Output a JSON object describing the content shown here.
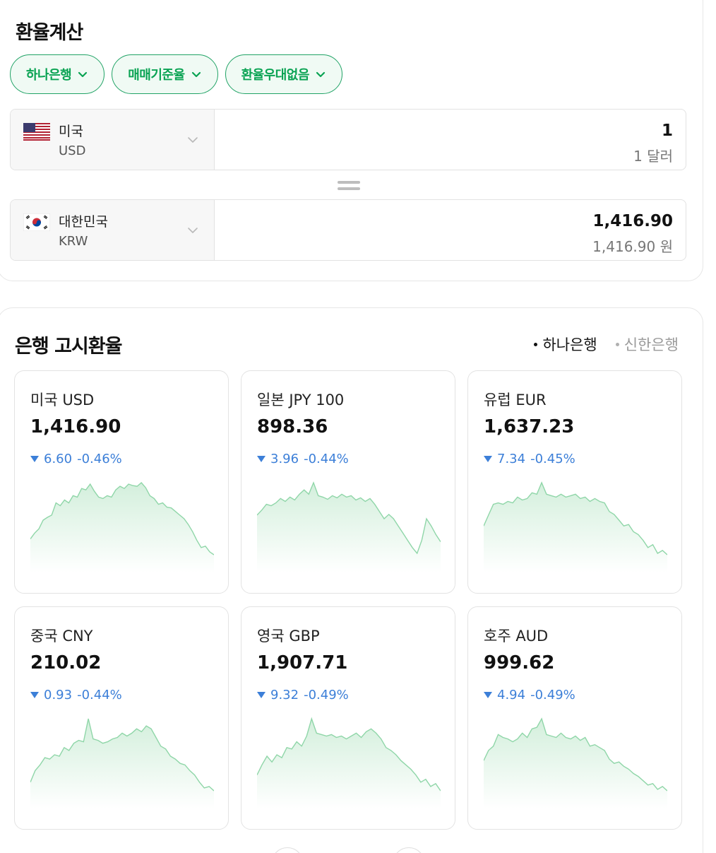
{
  "calculator": {
    "title": "환율계산",
    "filters": [
      {
        "label": "하나은행"
      },
      {
        "label": "매매기준율"
      },
      {
        "label": "환율우대없음"
      }
    ],
    "from": {
      "name": "미국",
      "code": "USD",
      "value": "1",
      "sub": "1 달러",
      "flag": "us-flag-icon"
    },
    "to": {
      "name": "대한민국",
      "code": "KRW",
      "value": "1,416.90",
      "sub": "1,416.90 원",
      "flag": "kr-flag-icon"
    }
  },
  "rates": {
    "title": "은행 고시환율",
    "banks": [
      {
        "label": "하나은행",
        "active": true
      },
      {
        "label": "신한은행",
        "active": false
      }
    ],
    "cards": [
      {
        "name": "미국 USD",
        "rate": "1,416.90",
        "change": "6.60",
        "pct": "-0.46%",
        "trend": [
          0.22,
          0.3,
          0.36,
          0.48,
          0.52,
          0.55,
          0.72,
          0.68,
          0.76,
          0.72,
          0.82,
          0.8,
          0.92,
          0.9,
          0.98,
          0.88,
          0.8,
          0.78,
          0.82,
          0.8,
          0.9,
          0.95,
          0.92,
          0.98,
          0.96,
          0.95,
          1.0,
          0.93,
          0.82,
          0.78,
          0.7,
          0.72,
          0.66,
          0.65,
          0.6,
          0.55,
          0.5,
          0.42,
          0.32,
          0.2,
          0.1,
          0.12,
          0.04,
          0.0
        ]
      },
      {
        "name": "일본 JPY 100",
        "rate": "898.36",
        "change": "3.96",
        "pct": "-0.44%",
        "trend": [
          0.55,
          0.62,
          0.7,
          0.68,
          0.72,
          0.78,
          0.74,
          0.8,
          0.76,
          0.84,
          0.9,
          0.84,
          1.0,
          0.82,
          0.8,
          0.77,
          0.82,
          0.79,
          0.84,
          0.8,
          0.82,
          0.76,
          0.79,
          0.74,
          0.78,
          0.7,
          0.6,
          0.5,
          0.56,
          0.5,
          0.4,
          0.3,
          0.2,
          0.1,
          0.02,
          0.2,
          0.5,
          0.4,
          0.28,
          0.18
        ]
      },
      {
        "name": "유럽 EUR",
        "rate": "1,637.23",
        "change": "7.34",
        "pct": "-0.45%",
        "trend": [
          0.4,
          0.55,
          0.7,
          0.72,
          0.7,
          0.74,
          0.72,
          0.8,
          0.76,
          0.78,
          0.86,
          0.84,
          1.0,
          0.84,
          0.82,
          0.8,
          0.84,
          0.8,
          0.82,
          0.84,
          0.78,
          0.8,
          0.74,
          0.78,
          0.74,
          0.72,
          0.6,
          0.56,
          0.48,
          0.4,
          0.42,
          0.32,
          0.28,
          0.2,
          0.1,
          0.14,
          0.02,
          0.06,
          0.0
        ]
      },
      {
        "name": "중국 CNY",
        "rate": "210.02",
        "change": "0.93",
        "pct": "-0.44%",
        "trend": [
          0.12,
          0.28,
          0.36,
          0.46,
          0.44,
          0.5,
          0.48,
          0.6,
          0.56,
          0.66,
          0.7,
          0.68,
          1.0,
          0.72,
          0.7,
          0.66,
          0.68,
          0.72,
          0.74,
          0.8,
          0.76,
          0.8,
          0.86,
          0.82,
          0.9,
          0.86,
          0.74,
          0.62,
          0.58,
          0.48,
          0.44,
          0.38,
          0.36,
          0.28,
          0.22,
          0.12,
          0.04,
          0.06,
          0.0
        ]
      },
      {
        "name": "영국 GBP",
        "rate": "1,907.71",
        "change": "9.32",
        "pct": "-0.49%",
        "trend": [
          0.22,
          0.36,
          0.48,
          0.4,
          0.5,
          0.46,
          0.6,
          0.58,
          0.68,
          0.62,
          0.76,
          1.0,
          0.8,
          0.78,
          0.76,
          0.78,
          0.74,
          0.76,
          0.72,
          0.76,
          0.8,
          0.74,
          0.82,
          0.86,
          0.8,
          0.72,
          0.6,
          0.56,
          0.5,
          0.42,
          0.36,
          0.3,
          0.22,
          0.12,
          0.16,
          0.06,
          0.1,
          0.0
        ]
      },
      {
        "name": "호주 AUD",
        "rate": "999.62",
        "change": "4.94",
        "pct": "-0.49%",
        "trend": [
          0.42,
          0.56,
          0.62,
          0.78,
          0.74,
          0.72,
          0.68,
          0.72,
          0.8,
          0.74,
          0.86,
          0.88,
          1.0,
          0.78,
          0.76,
          0.74,
          0.8,
          0.74,
          0.72,
          0.76,
          0.7,
          0.74,
          0.62,
          0.64,
          0.6,
          0.56,
          0.44,
          0.38,
          0.4,
          0.34,
          0.3,
          0.24,
          0.2,
          0.14,
          0.08,
          0.1,
          0.02,
          0.06,
          0.0
        ]
      }
    ]
  },
  "colors": {
    "accent": "#0aa353",
    "down": "#3c7fd8",
    "chart_line": "#8fd6a8"
  }
}
